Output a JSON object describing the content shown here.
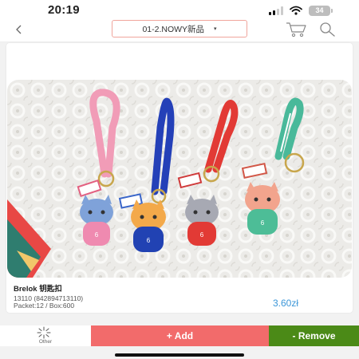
{
  "status_bar": {
    "time": "20:19",
    "battery": "34"
  },
  "nav": {
    "category": "01-2.NOWY新品",
    "caret": "▾"
  },
  "product": {
    "title": "Brelok 钥匙扣",
    "code": "13110 (842894713110)",
    "packet": "Packet:12 / Box:600",
    "price": "3.60zł",
    "image_icon": "keychain-photo"
  },
  "bottom": {
    "other_label": "Other",
    "add_label": "+ Add",
    "remove_label": "- Remove"
  },
  "colors": {
    "add": "#f26b6b",
    "remove": "#4b8a17",
    "price": "#3b96d8",
    "select_border": "#f0a59c"
  }
}
